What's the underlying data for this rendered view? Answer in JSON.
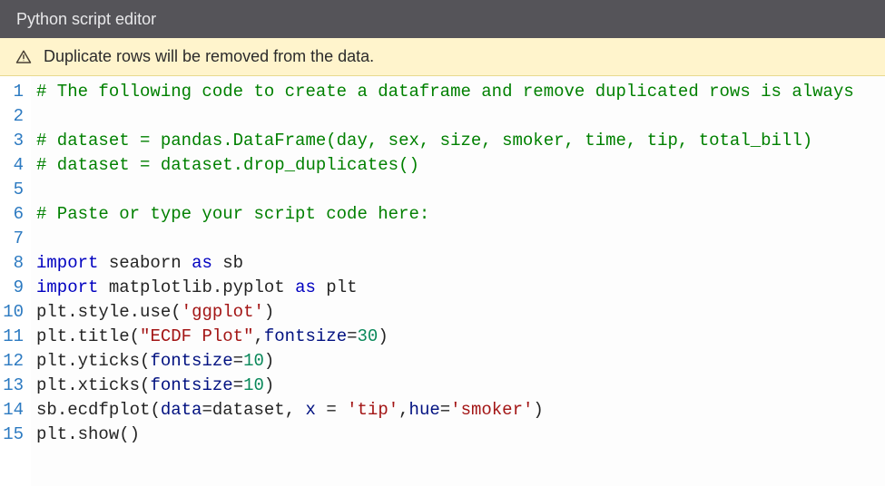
{
  "titlebar": {
    "text": "Python script editor"
  },
  "warning": {
    "text": "Duplicate rows will be removed from the data."
  },
  "icons": {
    "warning": "warning-triangle-icon"
  },
  "editor": {
    "gutter": [
      "1",
      "2",
      "3",
      "4",
      "5",
      "6",
      "7",
      "8",
      "9",
      "10",
      "11",
      "12",
      "13",
      "14",
      "15"
    ],
    "lines": [
      [
        {
          "t": "comment",
          "v": "# The following code to create a dataframe and remove duplicated rows is always"
        }
      ],
      [],
      [
        {
          "t": "comment",
          "v": "# dataset = pandas.DataFrame(day, sex, size, smoker, time, tip, total_bill)"
        }
      ],
      [
        {
          "t": "comment",
          "v": "# dataset = dataset.drop_duplicates()"
        }
      ],
      [],
      [
        {
          "t": "comment",
          "v": "# Paste or type your script code here:"
        }
      ],
      [],
      [
        {
          "t": "keyword",
          "v": "import"
        },
        {
          "t": "punct",
          "v": " "
        },
        {
          "t": "module",
          "v": "seaborn"
        },
        {
          "t": "punct",
          "v": " "
        },
        {
          "t": "keyword",
          "v": "as"
        },
        {
          "t": "punct",
          "v": " "
        },
        {
          "t": "module",
          "v": "sb"
        }
      ],
      [
        {
          "t": "keyword",
          "v": "import"
        },
        {
          "t": "punct",
          "v": " "
        },
        {
          "t": "module",
          "v": "matplotlib.pyplot"
        },
        {
          "t": "punct",
          "v": " "
        },
        {
          "t": "keyword",
          "v": "as"
        },
        {
          "t": "punct",
          "v": " "
        },
        {
          "t": "module",
          "v": "plt"
        }
      ],
      [
        {
          "t": "ident",
          "v": "plt"
        },
        {
          "t": "punct",
          "v": "."
        },
        {
          "t": "ident",
          "v": "style"
        },
        {
          "t": "punct",
          "v": "."
        },
        {
          "t": "func",
          "v": "use"
        },
        {
          "t": "punct",
          "v": "("
        },
        {
          "t": "string",
          "v": "'ggplot'"
        },
        {
          "t": "punct",
          "v": ")"
        }
      ],
      [
        {
          "t": "ident",
          "v": "plt"
        },
        {
          "t": "punct",
          "v": "."
        },
        {
          "t": "func",
          "v": "title"
        },
        {
          "t": "punct",
          "v": "("
        },
        {
          "t": "string",
          "v": "\"ECDF Plot\""
        },
        {
          "t": "punct",
          "v": ","
        },
        {
          "t": "param",
          "v": "fontsize"
        },
        {
          "t": "op",
          "v": "="
        },
        {
          "t": "number",
          "v": "30"
        },
        {
          "t": "punct",
          "v": ")"
        }
      ],
      [
        {
          "t": "ident",
          "v": "plt"
        },
        {
          "t": "punct",
          "v": "."
        },
        {
          "t": "func",
          "v": "yticks"
        },
        {
          "t": "punct",
          "v": "("
        },
        {
          "t": "param",
          "v": "fontsize"
        },
        {
          "t": "op",
          "v": "="
        },
        {
          "t": "number",
          "v": "10"
        },
        {
          "t": "punct",
          "v": ")"
        }
      ],
      [
        {
          "t": "ident",
          "v": "plt"
        },
        {
          "t": "punct",
          "v": "."
        },
        {
          "t": "func",
          "v": "xticks"
        },
        {
          "t": "punct",
          "v": "("
        },
        {
          "t": "param",
          "v": "fontsize"
        },
        {
          "t": "op",
          "v": "="
        },
        {
          "t": "number",
          "v": "10"
        },
        {
          "t": "punct",
          "v": ")"
        }
      ],
      [
        {
          "t": "ident",
          "v": "sb"
        },
        {
          "t": "punct",
          "v": "."
        },
        {
          "t": "func",
          "v": "ecdfplot"
        },
        {
          "t": "punct",
          "v": "("
        },
        {
          "t": "param",
          "v": "data"
        },
        {
          "t": "op",
          "v": "="
        },
        {
          "t": "ident",
          "v": "dataset"
        },
        {
          "t": "punct",
          "v": ", "
        },
        {
          "t": "param",
          "v": "x"
        },
        {
          "t": "punct",
          "v": " "
        },
        {
          "t": "op",
          "v": "="
        },
        {
          "t": "punct",
          "v": " "
        },
        {
          "t": "string",
          "v": "'tip'"
        },
        {
          "t": "punct",
          "v": ","
        },
        {
          "t": "param",
          "v": "hue"
        },
        {
          "t": "op",
          "v": "="
        },
        {
          "t": "string",
          "v": "'smoker'"
        },
        {
          "t": "punct",
          "v": ")"
        }
      ],
      [
        {
          "t": "ident",
          "v": "plt"
        },
        {
          "t": "punct",
          "v": "."
        },
        {
          "t": "func",
          "v": "show"
        },
        {
          "t": "punct",
          "v": "()"
        }
      ]
    ],
    "tokenClasses": {
      "comment": "tok-comment",
      "keyword": "tok-keyword",
      "module": "tok-module",
      "ident": "tok-ident",
      "func": "tok-func",
      "string": "tok-string",
      "number": "tok-number",
      "param": "tok-param",
      "punct": "tok-punct",
      "op": "tok-op"
    }
  }
}
